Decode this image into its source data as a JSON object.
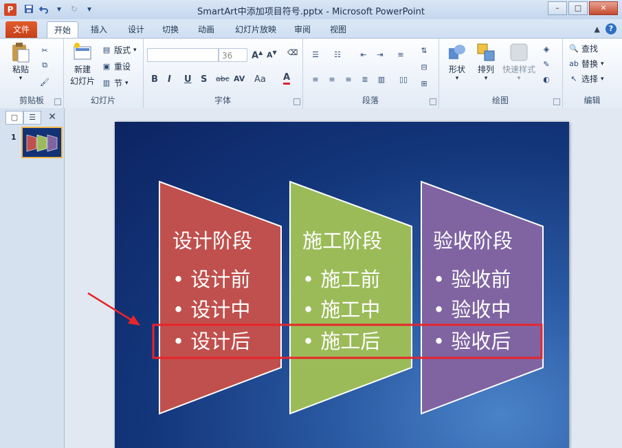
{
  "window": {
    "title": "SmartArt中添加项目符号.pptx - Microsoft PowerPoint",
    "app_icon": "P"
  },
  "tabs": [
    "文件",
    "开始",
    "插入",
    "设计",
    "切换",
    "动画",
    "幻灯片放映",
    "审阅",
    "视图"
  ],
  "ribbon": {
    "clipboard": {
      "paste": "粘贴",
      "label": "剪贴板"
    },
    "slides": {
      "new_slide_l1": "新建",
      "new_slide_l2": "幻灯片",
      "layout": "版式",
      "reset": "重设",
      "section": "节",
      "label": "幻灯片"
    },
    "font": {
      "size": "36",
      "label": "字体",
      "bold": "B",
      "italic": "I",
      "underline": "U",
      "shadow": "S",
      "strike": "abc",
      "font_color": "A",
      "case": "Aa"
    },
    "paragraph": {
      "label": "段落"
    },
    "drawing": {
      "shape": "形状",
      "arrange": "排列",
      "quick_style": "快速样式",
      "label": "绘图"
    },
    "editing": {
      "find": "查找",
      "replace": "替换",
      "select": "选择",
      "label": "编辑"
    }
  },
  "left_pane": {
    "slide_number": "1"
  },
  "slide": {
    "columns": [
      {
        "heading": "设计阶段",
        "bullets": [
          "设计前",
          "设计中",
          "设计后"
        ],
        "color": "#c0504d"
      },
      {
        "heading": "施工阶段",
        "bullets": [
          "施工前",
          "施工中",
          "施工后"
        ],
        "color": "#9bbb59"
      },
      {
        "heading": "验收阶段",
        "bullets": [
          "验收前",
          "验收中",
          "验收后"
        ],
        "color": "#8064a2"
      }
    ],
    "highlight_color": "#e8252a"
  }
}
